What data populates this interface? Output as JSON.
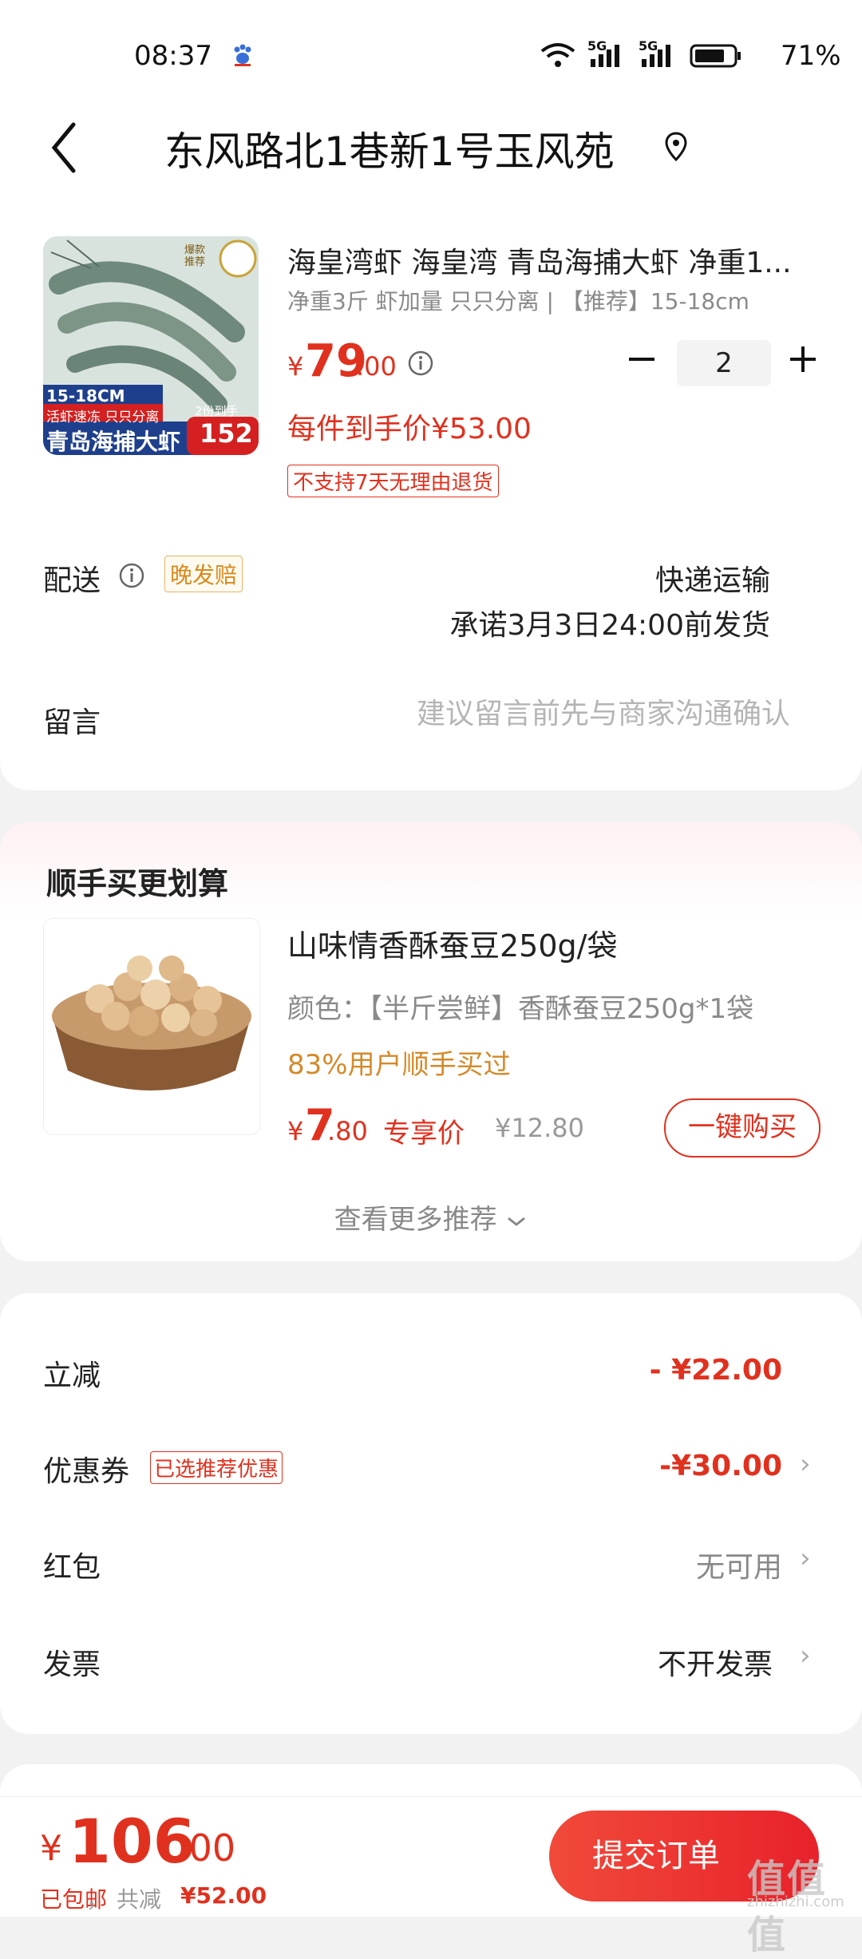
{
  "status_bar": {
    "time": "08:37",
    "battery": "71%",
    "net1": "5G",
    "net2": "5G"
  },
  "header": {
    "address": "东风路北1巷新1号玉风苑"
  },
  "product": {
    "title": "海皇湾虾 海皇湾 青岛海捕大虾 净重1...",
    "spec": "净重3斤 虾加量 只只分离 | 【推荐】15-18cm",
    "price_symbol": "¥",
    "price_int": "79",
    "price_dec": ".00",
    "quantity": "2",
    "unit_price": "每件到手价¥53.00",
    "no_return": "不支持7天无理由退货",
    "image_badge": "爆款推荐",
    "image_size": "15-18CM",
    "image_tag1": "活虾速冻 只只分离",
    "image_tag2": "青岛海捕大虾",
    "image_promo_label": "2份到手",
    "image_promo_price": "152"
  },
  "shipping": {
    "label": "配送",
    "badge": "晚发赔",
    "method": "快递运输",
    "promise": "承诺3月3日24:00前发货"
  },
  "message": {
    "label": "留言",
    "placeholder": "建议留言前先与商家沟通确认"
  },
  "upsell": {
    "title": "顺手买更划算",
    "item_title": "山味情香酥蚕豆250g/袋",
    "item_spec": "颜色：【半斤尝鲜】香酥蚕豆250g*1袋",
    "social": "83%用户顺手买过",
    "price_symbol": "¥",
    "price_int": "7",
    "price_dec": ".80",
    "price_tag": "专享价",
    "orig_price": "¥12.80",
    "buy_label": "一键购买",
    "more_label": "查看更多推荐"
  },
  "discounts": {
    "instant_label": "立减",
    "instant_value": "- ¥22.00",
    "coupon_label": "优惠券",
    "coupon_badge": "已选推荐优惠",
    "coupon_value": "-¥30.00",
    "redpacket_label": "红包",
    "redpacket_value": "无可用",
    "invoice_label": "发票",
    "invoice_value": "不开发票"
  },
  "bottom": {
    "total_symbol": "¥",
    "total_int": "106",
    "total_dec": ".00",
    "free_shipping": "已包邮",
    "separator": "，",
    "saved_label": "共减",
    "saved_value": "¥52.00",
    "submit_label": "提交订单",
    "watermark": "值值值",
    "watermark_sub": "zhizhizhi.com"
  },
  "colors": {
    "accent": "#e0311f",
    "orange": "#d48a2a",
    "muted": "#8a8a8a"
  }
}
